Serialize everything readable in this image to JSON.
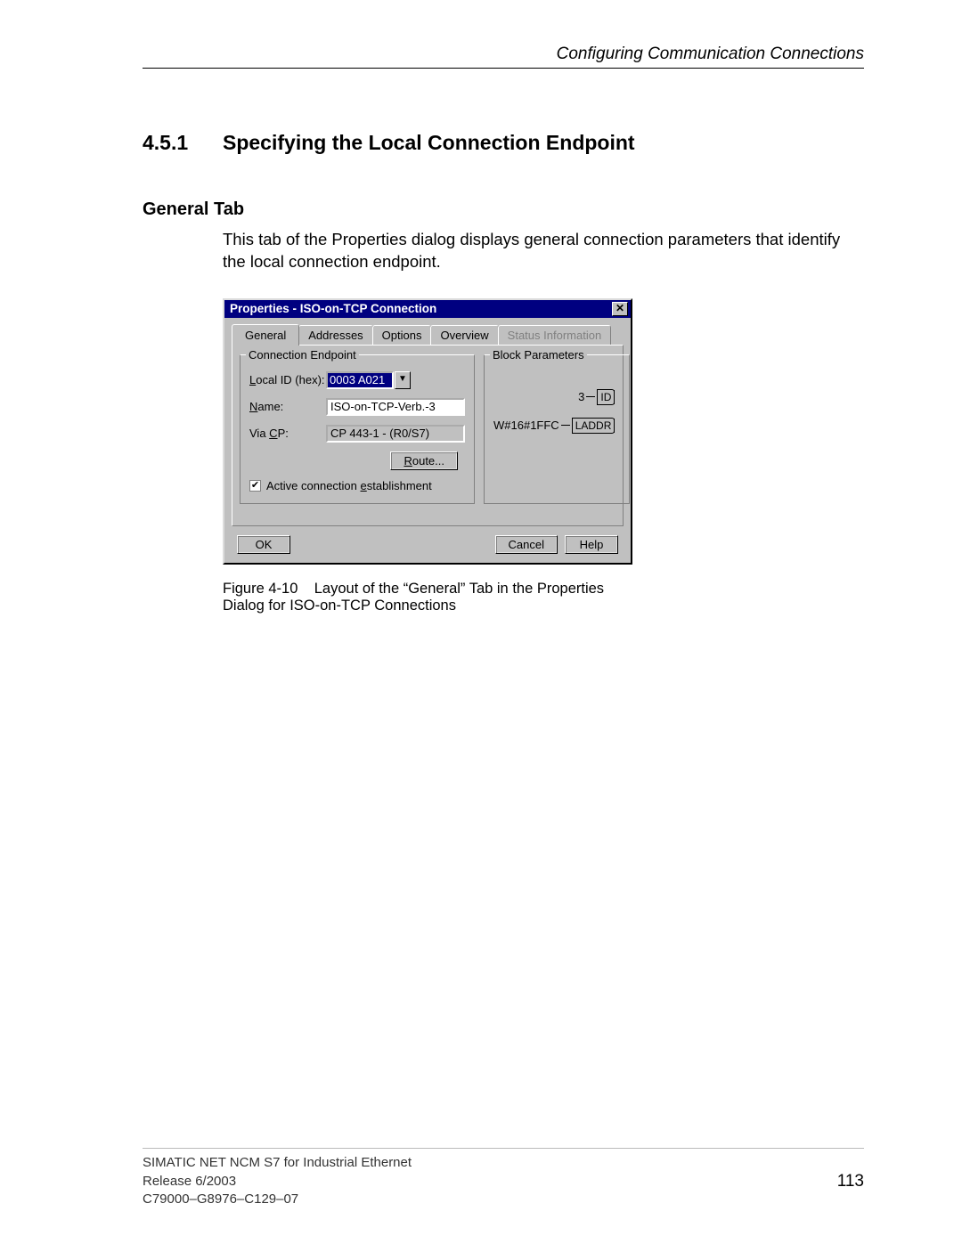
{
  "header": {
    "running_head": "Configuring Communication Connections"
  },
  "section": {
    "number": "4.5.1",
    "title": "Specifying the Local Connection Endpoint"
  },
  "subsection": {
    "heading": "General Tab",
    "body": "This tab of the Properties dialog displays general connection parameters that identify the local connection endpoint."
  },
  "dialog": {
    "title": "Properties - ISO-on-TCP Connection",
    "tabs": {
      "general": "General",
      "addresses": "Addresses",
      "options": "Options",
      "overview": "Overview",
      "status_info": "Status Information"
    },
    "group_connection": {
      "title": "Connection Endpoint",
      "local_id_label": "Local ID (hex):",
      "local_id_value": "0003 A021",
      "name_label": "Name:",
      "name_value": "ISO-on-TCP-Verb.-3",
      "via_cp_label": "Via CP:",
      "via_cp_value": "CP 443-1 - (R0/S7)",
      "route_button": "Route...",
      "active_checkbox": "Active connection establishment",
      "active_checked": true
    },
    "group_block": {
      "title": "Block Parameters",
      "id_value": "3",
      "id_label": "ID",
      "laddr_value": "W#16#1FFC",
      "laddr_label": "LADDR"
    },
    "buttons": {
      "ok": "OK",
      "cancel": "Cancel",
      "help": "Help"
    }
  },
  "figure": {
    "label": "Figure 4-10",
    "caption": "Layout of the “General” Tab in the Properties Dialog for ISO-on-TCP Connections"
  },
  "footer": {
    "line1": "SIMATIC NET NCM S7 for Industrial Ethernet",
    "line2": "Release 6/2003",
    "line3": "C79000–G8976–C129–07",
    "page": "113"
  }
}
